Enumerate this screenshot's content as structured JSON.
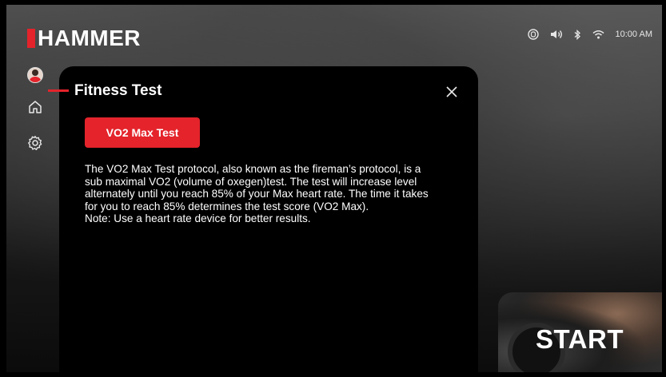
{
  "brand": {
    "name": "HAMMER",
    "accent_color": "#e4232b"
  },
  "status_bar": {
    "icons": [
      "heart-rate-sensor-icon",
      "volume-icon",
      "bluetooth-icon",
      "wifi-icon"
    ],
    "time": "10:00 AM"
  },
  "sidebar": {
    "items": [
      {
        "icon": "user-avatar-icon"
      },
      {
        "icon": "home-icon"
      },
      {
        "icon": "gear-icon"
      }
    ]
  },
  "modal": {
    "title": "Fitness Test",
    "test_button_label": "VO2 Max Test",
    "description_lines": [
      "The VO2 Max Test protocol, also known as the fireman’s protocol, is a",
      "sub maximal VO2 (volume of oxegen)test. The test will increase level",
      "alternately until you reach 85% of your Max heart rate. The time it takes",
      "for you to reach 85% determines the test score (VO2 Max).",
      "Note: Use a heart rate device for better results."
    ]
  },
  "start_card": {
    "label": "START"
  }
}
